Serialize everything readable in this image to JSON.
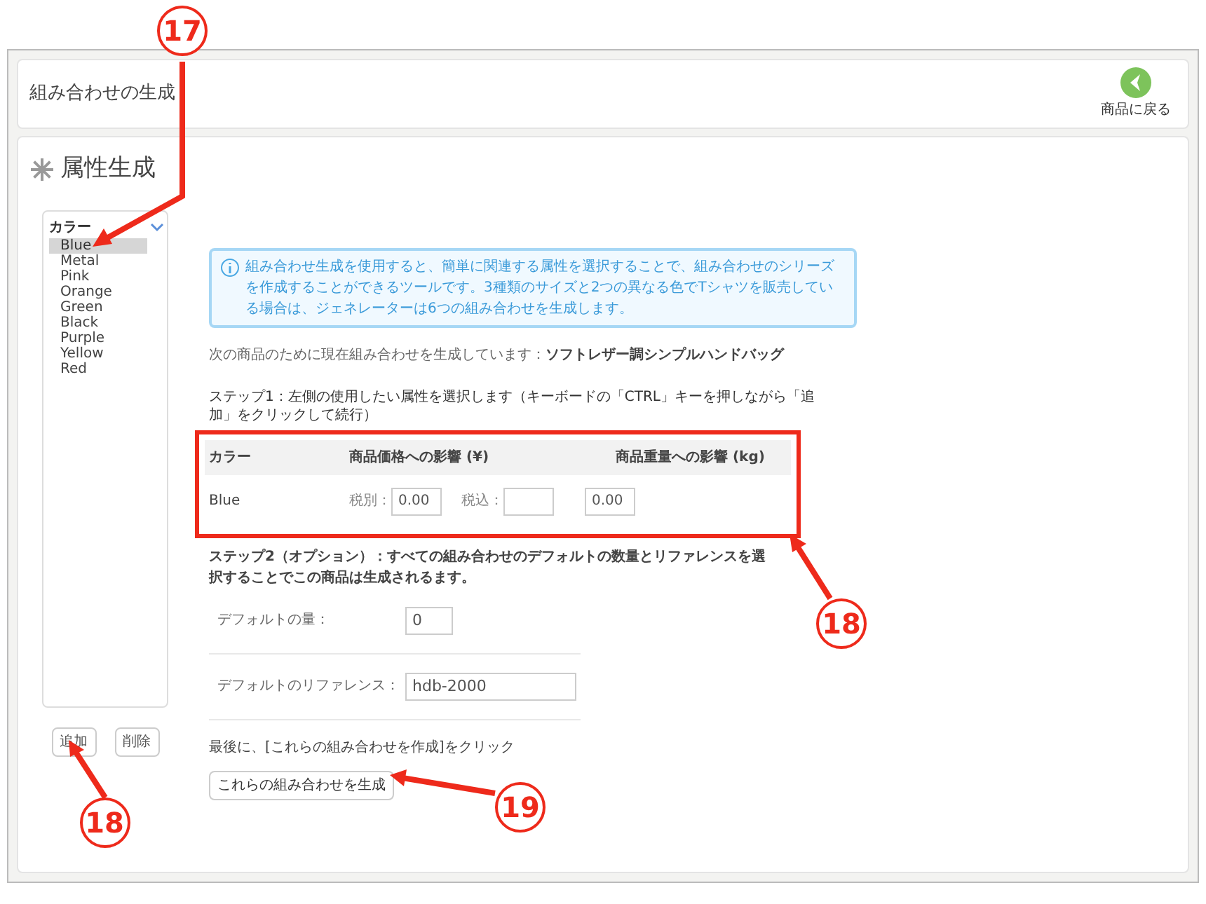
{
  "header": {
    "title": "組み合わせの生成",
    "back_button": "商品に戻る"
  },
  "section_title": "属性生成",
  "attribute_list": {
    "group": "カラー",
    "expanded": true,
    "items": [
      {
        "label": "Blue",
        "selected": true
      },
      {
        "label": "Metal",
        "selected": false
      },
      {
        "label": "Pink",
        "selected": false
      },
      {
        "label": "Orange",
        "selected": false
      },
      {
        "label": "Green",
        "selected": false
      },
      {
        "label": "Black",
        "selected": false
      },
      {
        "label": "Purple",
        "selected": false
      },
      {
        "label": "Yellow",
        "selected": false
      },
      {
        "label": "Red",
        "selected": false
      }
    ]
  },
  "list_buttons": [
    "追加",
    "削除"
  ],
  "info": "組み合わせ生成を使用すると、簡単に関連する属性を選択することで、組み合わせのシリーズを作成することができるツールです。3種類のサイズと2つの異なる色でTシャツを販売している場合は、ジェネレーターは6つの組み合わせを生成します。",
  "product_line": {
    "label": "次の商品のために現在組み合わせを生成しています：",
    "product": "ソフトレザー調シンプルハンドバッグ"
  },
  "step1": "ステップ1：左側の使用したい属性を選択します（キーボードの「CTRL」キーを押しながら「追加」をクリックして続行）",
  "table": {
    "columns": [
      "カラー",
      "商品価格への影響 (¥)",
      "商品重量への影響 (kg)"
    ],
    "rows": [
      {
        "name": "Blue",
        "tax_excluded_label": "税別：",
        "tax_excluded": "0.00",
        "tax_included_label": "税込：",
        "weight": "0.00"
      }
    ]
  },
  "step2": "ステップ2（オプション）：すべての組み合わせのデフォルトの数量とリファレンスを選択することでこの商品は生成されるます。",
  "fields": [
    {
      "label": "デフォルトの量：",
      "value": "0"
    },
    {
      "label": "デフォルトのリファレンス：",
      "value": "hdb-2000"
    }
  ],
  "final_note": "最後に、[これらの組み合わせを作成]をクリック",
  "generate_button": "これらの組み合わせを生成",
  "annotations": [
    {
      "number": "17"
    },
    {
      "number": "18"
    },
    {
      "number": "18"
    },
    {
      "number": "19"
    }
  ]
}
